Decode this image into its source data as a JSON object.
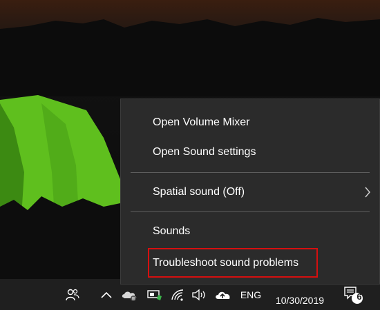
{
  "menu": {
    "items": [
      {
        "label": "Open Volume Mixer"
      },
      {
        "label": "Open Sound settings"
      },
      {
        "label": "Spatial sound (Off)"
      },
      {
        "label": "Sounds"
      },
      {
        "label": "Troubleshoot sound problems"
      }
    ]
  },
  "taskbar": {
    "language": "ENG",
    "date": "10/30/2019",
    "notification_count": "6",
    "icons": [
      "people-icon",
      "chevron-up-icon",
      "onedrive-sync-icon",
      "device-icon",
      "wifi-icon",
      "volume-icon",
      "cloud-upload-icon",
      "action-center-icon"
    ]
  },
  "colors": {
    "menu_bg": "#2b2b2b",
    "taskbar_bg": "#1f1f1f",
    "highlight_border": "#d60f0f",
    "tent_green": "#5fbf1e"
  }
}
